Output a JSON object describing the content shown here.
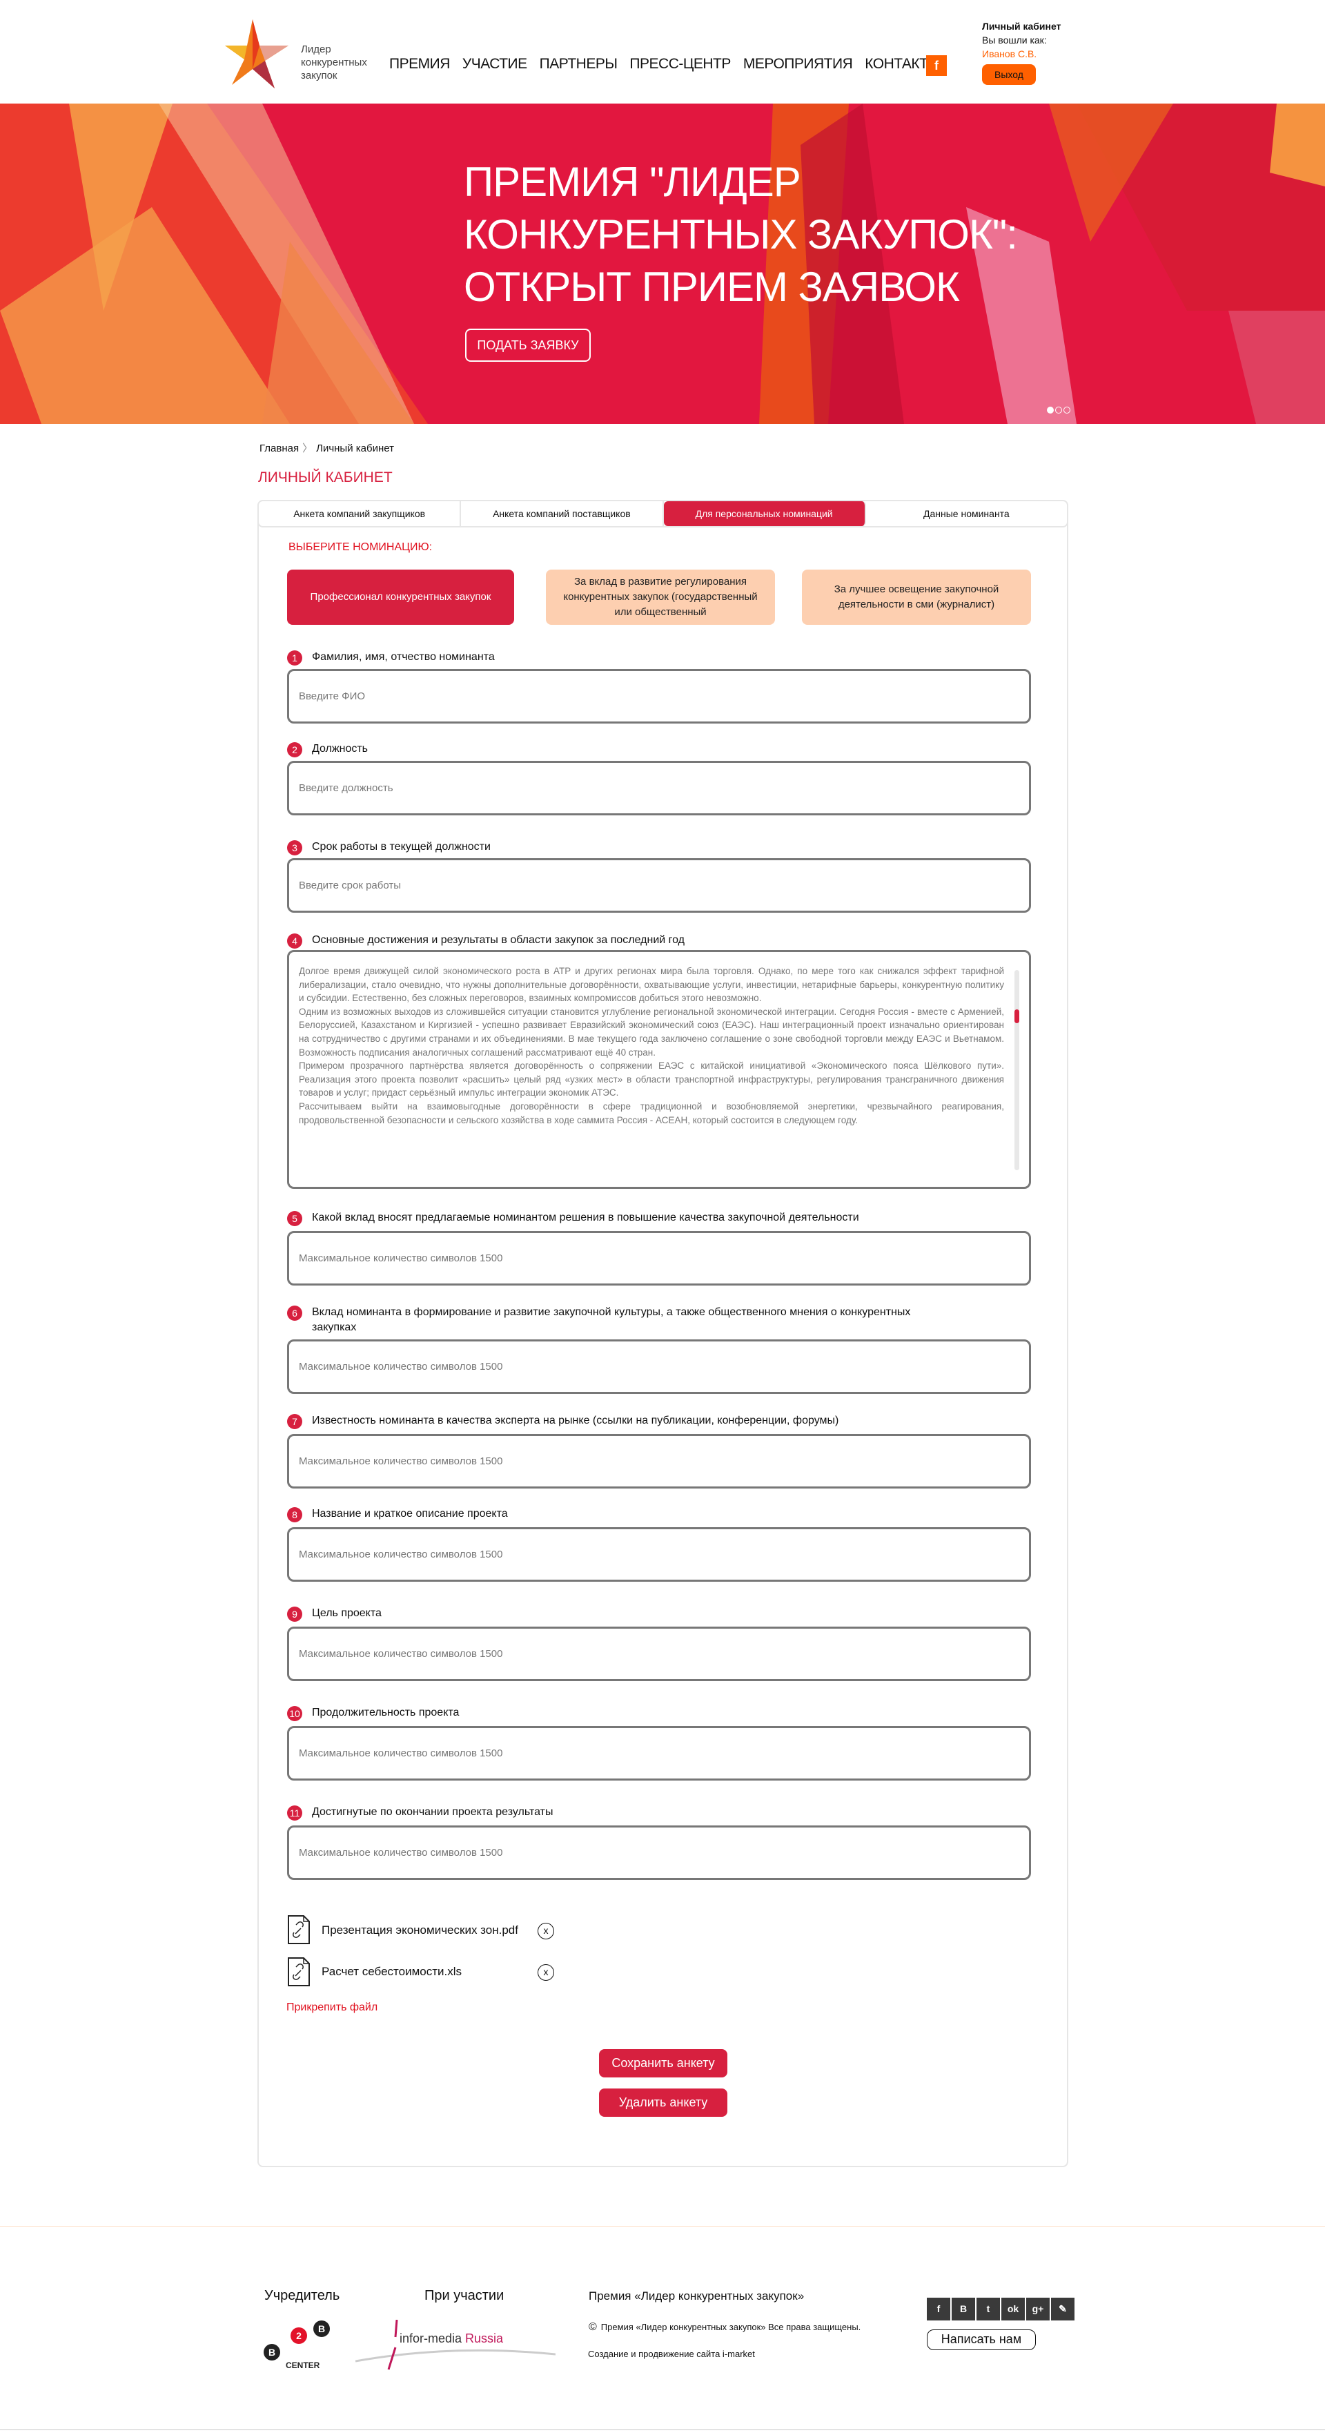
{
  "header": {
    "logo_text": [
      "Лидер",
      "конкурентных",
      "закупок"
    ],
    "nav": [
      "ПРЕМИЯ",
      "УЧАСТИЕ",
      "ПАРТНЕРЫ",
      "ПРЕСС-ЦЕНТР",
      "МЕРОПРИЯТИЯ",
      "КОНТАКТЫ"
    ],
    "facebook_icon": "f",
    "account": {
      "title": "Личный кабинет",
      "logged_as": "Вы вошли как:",
      "user": "Иванов С.В.",
      "logout": "Выход"
    }
  },
  "hero": {
    "title_lines": [
      "ПРЕМИЯ \"ЛИДЕР",
      "КОНКУРЕНТНЫХ ЗАКУПОК\":",
      "ОТКРЫТ ПРИЕМ ЗАЯВОК"
    ],
    "button": "ПОДАТЬ ЗАЯВКУ",
    "slides_total": 3,
    "slide_active": 1
  },
  "breadcrumb": [
    "Главная",
    "Личный кабинет"
  ],
  "page_title": "ЛИЧНЫЙ КАБИНЕТ",
  "tabs": [
    {
      "label": "Анкета компаний закупщиков",
      "active": false
    },
    {
      "label": "Анкета компаний поставщиков",
      "active": false
    },
    {
      "label": "Для персональных номинаций",
      "active": true
    },
    {
      "label": "Данные номинанта",
      "active": false
    }
  ],
  "nominations": {
    "heading": "ВЫБЕРИТЕ НОМИНАЦИЮ:",
    "items": [
      {
        "label": "Профессионал конкурентных закупок",
        "active": true
      },
      {
        "label": "За вклад в развитие регулирования конкурентных закупок (государственный или общественный",
        "active": false
      },
      {
        "label": "За лучшее освещение закупочной деятельности в сми (журналист)",
        "active": false
      }
    ]
  },
  "questions": [
    {
      "num": "1",
      "label": "Фамилия, имя, отчество номинанта",
      "placeholder": "Введите ФИО"
    },
    {
      "num": "2",
      "label": "Должность",
      "placeholder": "Введите должность"
    },
    {
      "num": "3",
      "label": "Срок работы в текущей должности",
      "placeholder": "Введите срок работы"
    },
    {
      "num": "4",
      "label": "Основные достижения и результаты в области закупок за последний год",
      "value": "Долгое время движущей силой экономического роста в АТР и других регионах мира была торговля. Однако, по мере того как снижался эффект тарифной либерализации, стало очевидно, что нужны дополнительные договорённости, охватывающие услуги, инвестиции, нетарифные барьеры, конкурентную политику и субсидии. Естественно, без сложных переговоров, взаимных компромиссов добиться этого невозможно.\nОдним из возможных выходов из сложившейся ситуации становится углубление региональной экономической интеграции. Сегодня Россия - вместе с Арменией, Белоруссией, Казахстаном и Киргизией - успешно развивает Евразийский экономический союз (ЕАЭС). Наш интеграционный проект изначально ориентирован на сотрудничество с другими странами и их объединениями. В мае текущего года заключено соглашение о зоне свободной торговли между ЕАЭС и Вьетнамом. Возможность подписания аналогичных соглашений рассматривают ещё 40 стран.\nПримером прозрачного партнёрства является договорённость о сопряжении ЕАЭС с китайской инициативой «Экономического пояса Шёлкового пути». Реализация этого проекта позволит «расшить» целый ряд «узких мест» в области транспортной инфраструктуры, регулирования трансграничного движения товаров и услуг; придаст серьёзный импульс интеграции экономик АТЭС.\nРассчитываем выйти на взаимовыгодные договорённости в сфере традиционной и возобновляемой энергетики, чрезвычайного реагирования, продовольственной безопасности и сельского хозяйства в ходе саммита Россия - АСЕАН, который состоится в следующем году."
    },
    {
      "num": "5",
      "label": "Какой вклад вносят предлагаемые номинантом решения в повышение качества закупочной деятельности",
      "placeholder": "Максимальное количество символов 1500"
    },
    {
      "num": "6",
      "label": "Вклад номинанта в формирование и развитие закупочной культуры, а также общественного мнения о конкурентных закупках",
      "placeholder": "Максимальное количество символов 1500"
    },
    {
      "num": "7",
      "label": "Известность номинанта в качества эксперта на рынке (ссылки на публикации, конференции, форумы)",
      "placeholder": "Максимальное количество символов 1500"
    },
    {
      "num": "8",
      "label": "Название и краткое описание проекта",
      "placeholder": "Максимальное количество символов 1500"
    },
    {
      "num": "9",
      "label": "Цель проекта",
      "placeholder": "Максимальное количество символов 1500"
    },
    {
      "num": "10",
      "label": "Продолжительность проекта",
      "placeholder": "Максимальное количество символов 1500"
    },
    {
      "num": "11",
      "label": "Достигнутые по окончании проекта результаты",
      "placeholder": "Максимальное количество символов 1500"
    }
  ],
  "files": [
    "Презентация экономических зон.pdf",
    "Расчет себестоимости.xls"
  ],
  "attach_label": "Прикрепить файл",
  "actions": {
    "save": "Сохранить анкету",
    "delete": "Удалить  анкету"
  },
  "footer": {
    "founder": "Учредитель",
    "participation": "При участии",
    "award_title": "Премия «Лидер конкурентных закупок»",
    "copyright": "Премия «Лидер конкурентных закупок» Все права защищены.",
    "credits": "Создание и продвижение сайта i-market",
    "b2b_logo": "B2B CENTER",
    "infor_logo": "infor-media Russia",
    "social_icons": [
      "f",
      "В",
      "t",
      "ok",
      "g+",
      "✎"
    ],
    "write_us": "Написать нам"
  },
  "colors": {
    "accent": "#d7203f",
    "orange": "#ff6000",
    "peach": "#fdcfb0"
  }
}
